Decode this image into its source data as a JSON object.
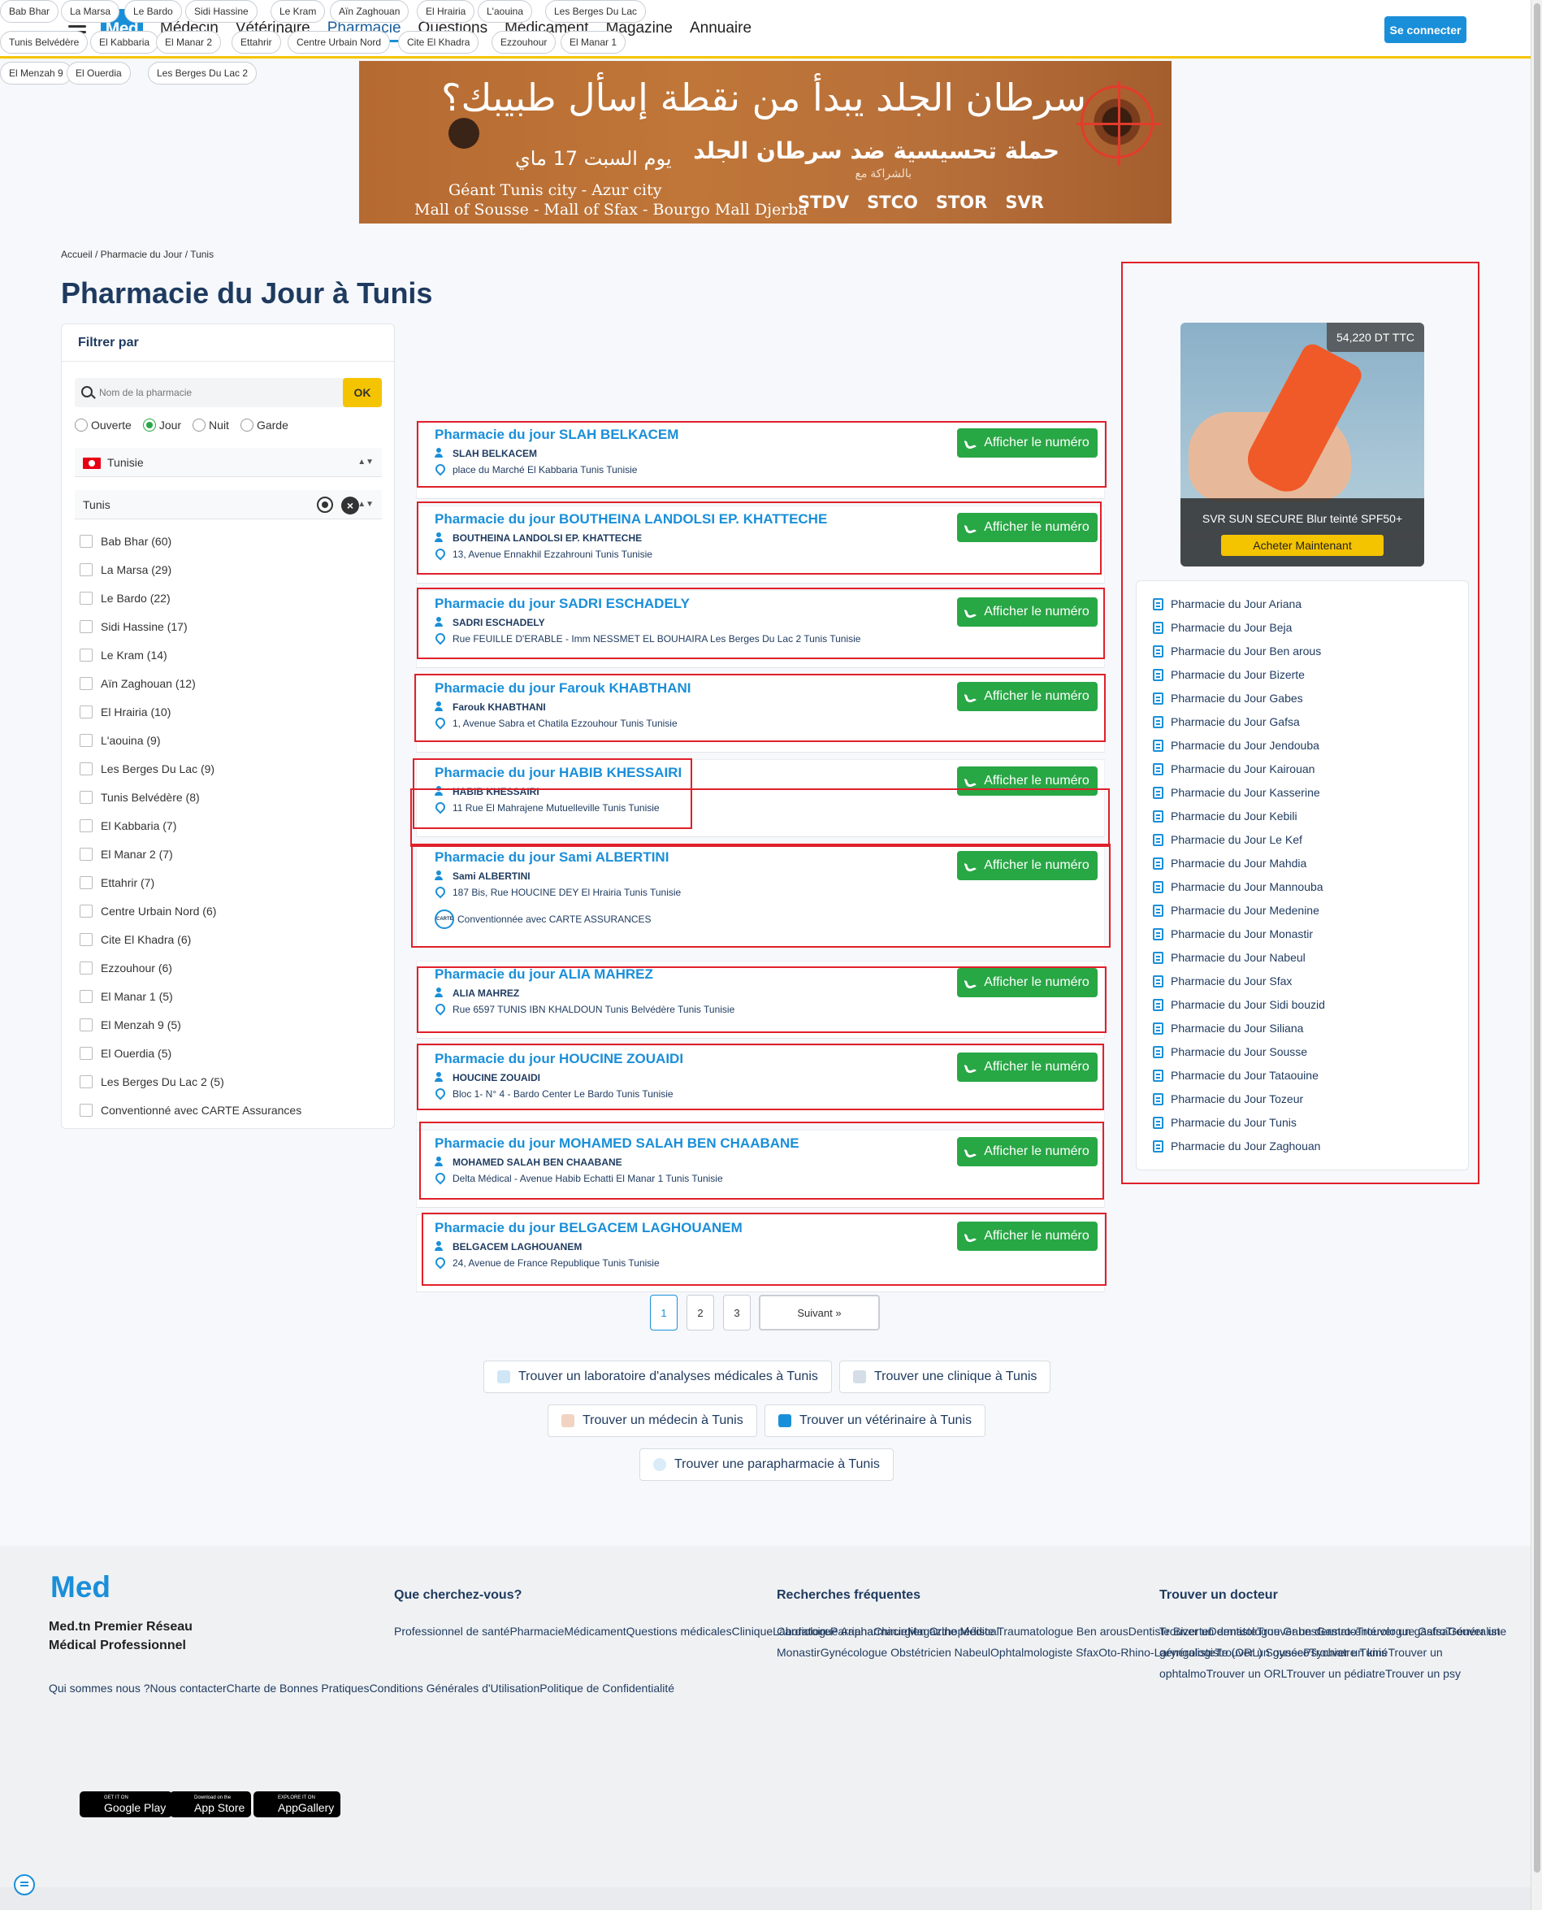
{
  "nav": {
    "logo": "Med",
    "items": [
      "Médecin",
      "Vétérinaire",
      "Pharmacie",
      "Questions",
      "Médicament",
      "Magazine",
      "Annuaire"
    ],
    "login": "Se connecter"
  },
  "banner": {
    "line1": "سرطان الجلد يبدأ من نقطة إسأل طبيبك؟",
    "line2": "حملة تحسيسية ضد سرطان الجلد",
    "date": "يوم السبت 17 ماي",
    "partner": "بالشراكة مع",
    "loc1": "Géant Tunis city - Azur city",
    "loc2": "Mall of Sousse - Mall of Sfax - Bourgo Mall Djerba",
    "sponsors": [
      "STDV",
      "STCO",
      "STOR",
      "SVR"
    ]
  },
  "breadcrumb": "Accueil / Pharmacie du Jour / Tunis",
  "title": "Pharmacie du Jour à Tunis",
  "filter": {
    "title": "Filtrer par",
    "search_placeholder": "Nom de la pharmacie",
    "ok": "OK",
    "radios": [
      "Ouverte",
      "Jour",
      "Nuit",
      "Garde"
    ],
    "country": "Tunisie",
    "city": "Tunis",
    "clear": "×",
    "checks": [
      "Bab Bhar (60)",
      "La Marsa (29)",
      "Le Bardo (22)",
      "Sidi Hassine (17)",
      "Le Kram (14)",
      "Aïn Zaghouan (12)",
      "El Hrairia (10)",
      "L'aouina (9)",
      "Les Berges Du Lac (9)",
      "Tunis Belvédère (8)",
      "El Kabbaria (7)",
      "El Manar 2 (7)",
      "Ettahrir (7)",
      "Centre Urbain Nord (6)",
      "Cite El Khadra (6)",
      "Ezzouhour (6)",
      "El Manar 1 (5)",
      "El Menzah 9 (5)",
      "El Ouerdia (5)",
      "Les Berges Du Lac 2 (5)",
      "Conventionné avec CARTE Assurances"
    ]
  },
  "chips": [
    "Bab Bhar",
    "La Marsa",
    "Le Bardo",
    "Sidi Hassine",
    "Le Kram",
    "Aïn Zaghouan",
    "El Hrairia",
    "L'aouina",
    "Les Berges Du Lac",
    "Tunis Belvédère",
    "El Kabbaria",
    "El Manar 2",
    "Ettahrir",
    "Centre Urbain Nord",
    "Cite El Khadra",
    "Ezzouhour",
    "El Manar 1",
    "El Menzah 9",
    "El Ouerdia",
    "Les Berges Du Lac 2"
  ],
  "show_number": "Afficher le numéro",
  "cards": [
    {
      "title": "Pharmacie du jour SLAH BELKACEM",
      "name": "SLAH BELKACEM",
      "addr": "place du Marché El Kabbaria Tunis Tunisie"
    },
    {
      "title": "Pharmacie du jour BOUTHEINA LANDOLSI EP. KHATTECHE",
      "name": "BOUTHEINA LANDOLSI EP. KHATTECHE",
      "addr": "13, Avenue Ennakhil Ezzahrouni Tunis Tunisie"
    },
    {
      "title": "Pharmacie du jour SADRI ESCHADELY",
      "name": "SADRI ESCHADELY",
      "addr": "Rue FEUILLE D'ERABLE - Imm NESSMET EL BOUHAIRA Les Berges Du Lac 2 Tunis Tunisie"
    },
    {
      "title": "Pharmacie du jour Farouk KHABTHANI",
      "name": "Farouk KHABTHANI",
      "addr": "1, Avenue Sabra et Chatila Ezzouhour Tunis Tunisie"
    },
    {
      "title": "Pharmacie du jour HABIB KHESSAIRI",
      "name": "HABIB KHESSAIRI",
      "addr": "11 Rue El Mahrajene Mutuelleville Tunis Tunisie"
    },
    {
      "title": "Pharmacie du jour Sami ALBERTINI",
      "name": "Sami ALBERTINI",
      "addr": "187 Bis, Rue HOUCINE DEY El Hrairia Tunis Tunisie",
      "carte": "Conventionnée avec CARTE ASSURANCES",
      "carte_logo": "CARTE"
    },
    {
      "title": "Pharmacie du jour ALIA MAHREZ",
      "name": "ALIA MAHREZ",
      "addr": "Rue 6597 TUNIS IBN KHALDOUN Tunis Belvédère Tunis Tunisie"
    },
    {
      "title": "Pharmacie du jour HOUCINE ZOUAIDI",
      "name": "HOUCINE ZOUAIDI",
      "addr": "Bloc 1- N° 4 - Bardo Center Le Bardo Tunis Tunisie"
    },
    {
      "title": "Pharmacie du jour MOHAMED SALAH BEN CHAABANE",
      "name": "MOHAMED SALAH BEN CHAABANE",
      "addr": "Delta Médical - Avenue Habib Echatti El Manar 1 Tunis Tunisie"
    },
    {
      "title": "Pharmacie du jour BELGACEM LAGHOUANEM",
      "name": "BELGACEM LAGHOUANEM",
      "addr": "24, Avenue de France Republique Tunis Tunisie"
    }
  ],
  "pagination": [
    "1",
    "2",
    "3",
    "Suivant »"
  ],
  "find_links": [
    "Trouver un laboratoire d'analyses médicales à Tunis",
    "Trouver une clinique à Tunis",
    "Trouver un médecin à Tunis",
    "Trouver un vétérinaire à Tunis",
    "Trouver une parapharmacie à Tunis"
  ],
  "ad": {
    "price": "54,220 DT TTC",
    "product": "SVR SUN SECURE Blur teinté SPF50+",
    "buy": "Acheter Maintenant",
    "brand": "SVR",
    "spf": "50+"
  },
  "cities": [
    "Pharmacie du Jour Ariana",
    "Pharmacie du Jour Beja",
    "Pharmacie du Jour Ben arous",
    "Pharmacie du Jour Bizerte",
    "Pharmacie du Jour Gabes",
    "Pharmacie du Jour Gafsa",
    "Pharmacie du Jour Jendouba",
    "Pharmacie du Jour Kairouan",
    "Pharmacie du Jour Kasserine",
    "Pharmacie du Jour Kebili",
    "Pharmacie du Jour Le Kef",
    "Pharmacie du Jour Mahdia",
    "Pharmacie du Jour Mannouba",
    "Pharmacie du Jour Medenine",
    "Pharmacie du Jour Monastir",
    "Pharmacie du Jour Nabeul",
    "Pharmacie du Jour Sfax",
    "Pharmacie du Jour Sidi bouzid",
    "Pharmacie du Jour Siliana",
    "Pharmacie du Jour Sousse",
    "Pharmacie du Jour Tataouine",
    "Pharmacie du Jour Tozeur",
    "Pharmacie du Jour Tunis",
    "Pharmacie du Jour Zaghouan"
  ],
  "footer": {
    "logo": "Med",
    "tagline": "Med.tn Premier Réseau Médical Professionnel",
    "about": [
      "Qui sommes nous ?",
      "Nous contacter",
      "Charte de Bonnes Pratiques",
      "Conditions Générales d'Utilisation",
      "Politique de Confidentialité"
    ],
    "stores": [
      {
        "small": "GET IT ON",
        "big": "Google Play"
      },
      {
        "small": "Download on the",
        "big": "App Store"
      },
      {
        "small": "EXPLORE IT ON",
        "big": "AppGallery"
      }
    ],
    "col1": {
      "title": "Que cherchez-vous?",
      "links": [
        "Professionnel de santé",
        "Pharmacie",
        "Médicament",
        "Questions médicales",
        "Clinique",
        "Laboratoire",
        "Parapharmacie",
        "Magazine Médical"
      ]
    },
    "col2": {
      "title": "Recherches fréquentes",
      "links": [
        "Cardiologue Ariana",
        "Chirurgien Orthopédiste Traumatologue Ben arous",
        "Dentiste Bizerte",
        "Dermatologue Gabes",
        "Gastro-entérologue Gafsa",
        "Généraliste Monastir",
        "Gynécologue Obstétricien Nabeul",
        "Ophtalmologiste Sfax",
        "Oto-Rhino-Laryngologiste (ORL) Sousse",
        "Psychiatre Tunis"
      ]
    },
    "col3": {
      "title": "Trouver un docteur",
      "links": [
        "Trouver un dentiste",
        "Trouver un dermato",
        "Trouver un gastro",
        "Trouver un généraliste",
        "Trouver un gynéco",
        "Trouver un kiné",
        "Trouver un ophtalmo",
        "Trouver un ORL",
        "Trouver un pédiatre",
        "Trouver un psy"
      ]
    }
  }
}
